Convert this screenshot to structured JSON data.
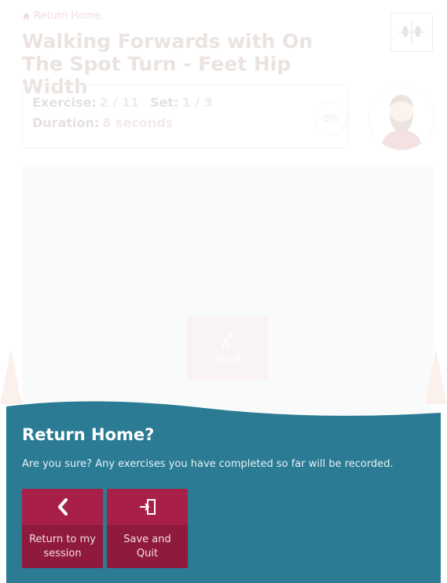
{
  "breadcrumb": {
    "label": "Return Home",
    "icon": "home-icon"
  },
  "exercise": {
    "title": "Walking Forwards with On The Spot Turn - Feet Hip Width",
    "exercise_label": "Exercise:",
    "exercise_value": "2 / 11",
    "set_label": "Set:",
    "set_value": "1 / 3",
    "duration_label": "Duration:",
    "duration_value": "8 seconds",
    "progress_text": "0%",
    "progress_fraction": 0
  },
  "video": {
    "start_label": "Start",
    "start_icon": "stretch-figure-icon"
  },
  "modal": {
    "title": "Return Home?",
    "message": "Are you sure? Any exercises you have completed so far will be recorded.",
    "return_label": "Return to my session",
    "return_icon": "chevron-left-icon",
    "quit_label": "Save and Quit",
    "quit_icon": "exit-door-icon"
  },
  "colors": {
    "brand": "#a01c42",
    "modal_bg": "#2a7b93",
    "video_bg": "#dbe7ea"
  }
}
